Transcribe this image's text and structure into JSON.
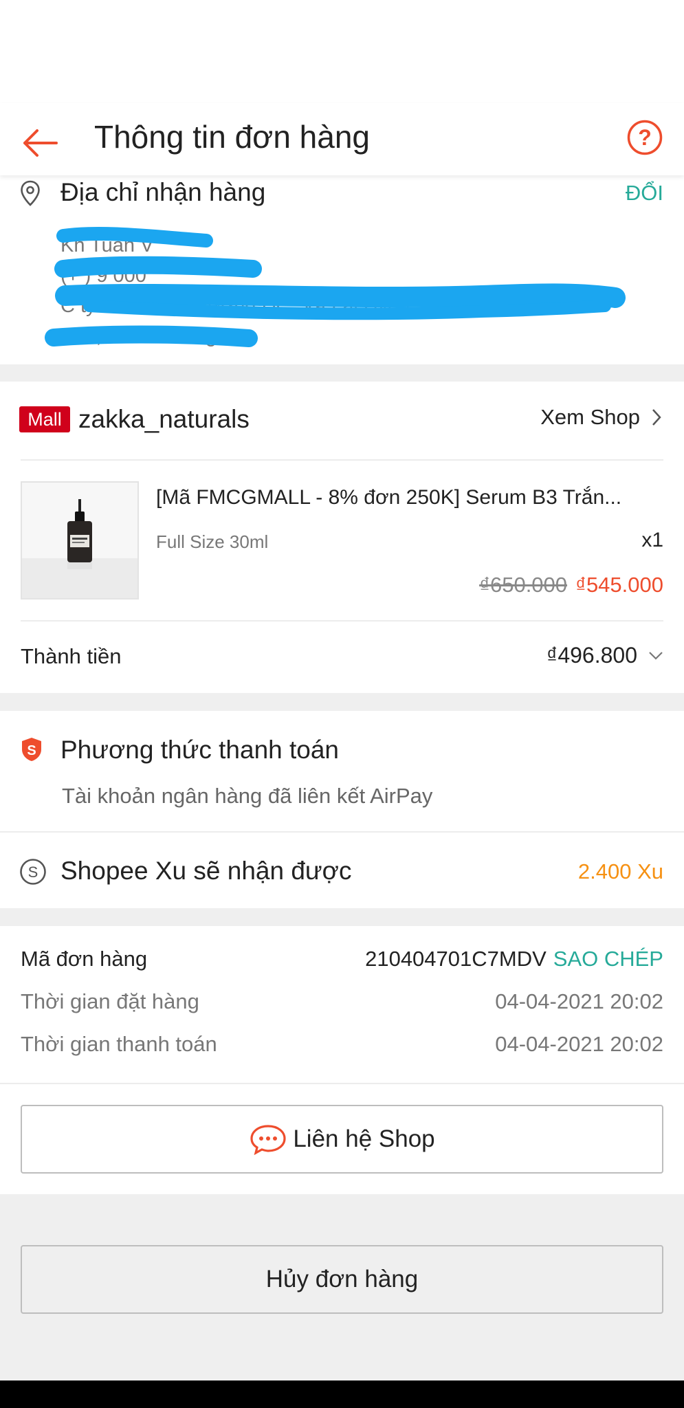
{
  "header": {
    "title": "Thông tin đơn hàng"
  },
  "address": {
    "label": "Địa chỉ nhận hàng",
    "change": "ĐỔI",
    "lines": [
      "Kh  Tuấn V",
      "(+  ) 9  000",
      "C  ty    tế Weston  đường DC, Xã Lai Uyên, H  yện    u",
      "Bàu, Bình Dương"
    ]
  },
  "shop": {
    "badge": "Mall",
    "name": "zakka_naturals",
    "view_shop": "Xem Shop",
    "product": {
      "title": "[Mã FMCGMALL - 8% đơn 250K] Serum B3 Trắn...",
      "variant": "Full Size 30ml",
      "qty": "x1",
      "old_price": "₫650.000",
      "price": "₫545.000"
    },
    "total_label": "Thành tiền",
    "total_value": "₫496.800"
  },
  "payment": {
    "label": "Phương thức thanh toán",
    "method": "Tài khoản ngân hàng đã liên kết AirPay",
    "coins_label": "Shopee Xu sẽ nhận được",
    "coins_value": "2.400 Xu"
  },
  "order": {
    "code_label": "Mã đơn hàng",
    "code_value": "210404701C7MDV",
    "copy": "SAO CHÉP",
    "order_time_label": "Thời gian đặt hàng",
    "order_time_value": "04-04-2021 20:02",
    "pay_time_label": "Thời gian thanh toán",
    "pay_time_value": "04-04-2021 20:02",
    "contact_button": "Liên hệ Shop"
  },
  "cancel_button": "Hủy đơn hàng",
  "colors": {
    "accent": "#ee4d2d",
    "teal": "#26aa99",
    "coin": "#f69113",
    "scribble": "#1ba6f0"
  }
}
